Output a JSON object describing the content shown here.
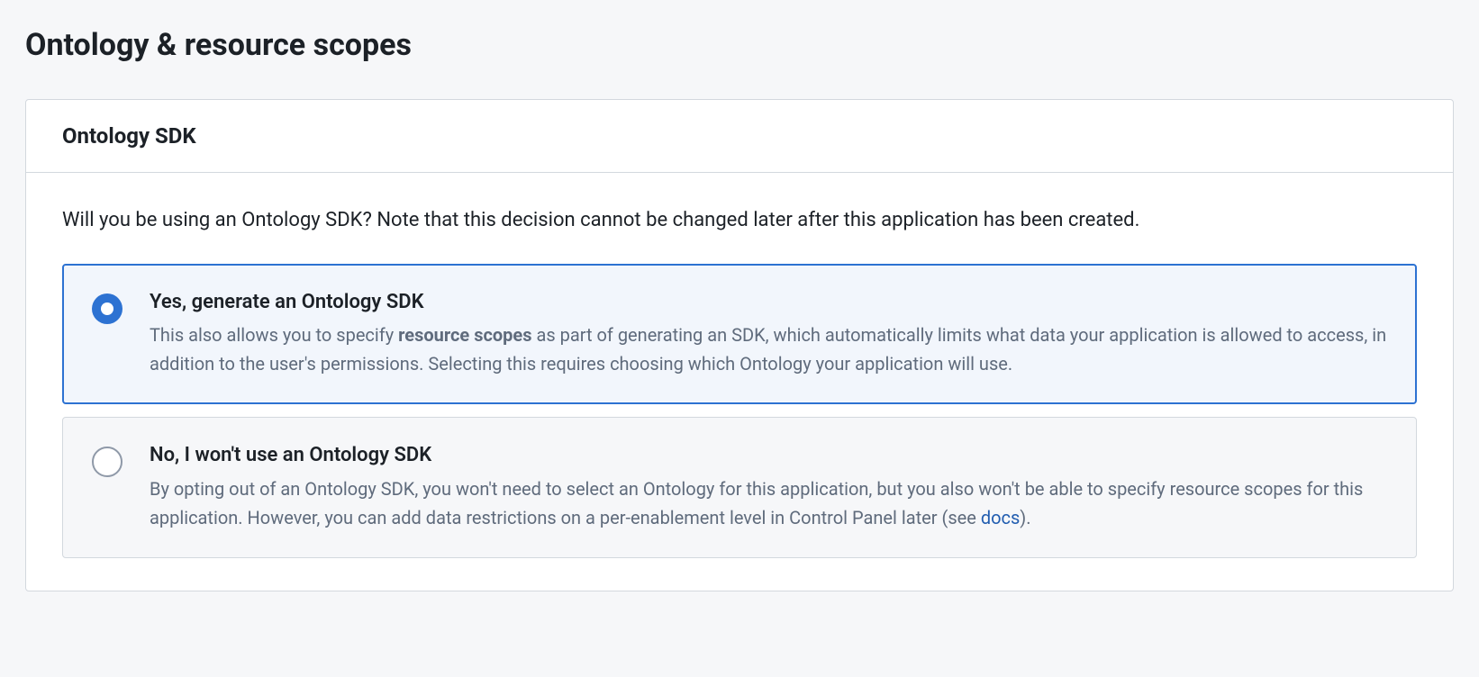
{
  "page": {
    "title": "Ontology & resource scopes"
  },
  "card": {
    "header_title": "Ontology SDK",
    "question": "Will you be using an Ontology SDK? Note that this decision cannot be changed later after this application has been created."
  },
  "options": {
    "yes": {
      "title": "Yes, generate an Ontology SDK",
      "desc_before": "This also allows you to specify ",
      "desc_bold": "resource scopes",
      "desc_after": " as part of generating an SDK, which automatically limits what data your application is allowed to access, in addition to the user's permissions. Selecting this requires choosing which Ontology your application will use."
    },
    "no": {
      "title": "No, I won't use an Ontology SDK",
      "desc_before": "By opting out of an Ontology SDK, you won't need to select an Ontology for this application, but you also won't be able to specify resource scopes for this application. However, you can add data restrictions on a per-enablement level in Control Panel later (see ",
      "desc_link": "docs",
      "desc_after": ")."
    }
  }
}
